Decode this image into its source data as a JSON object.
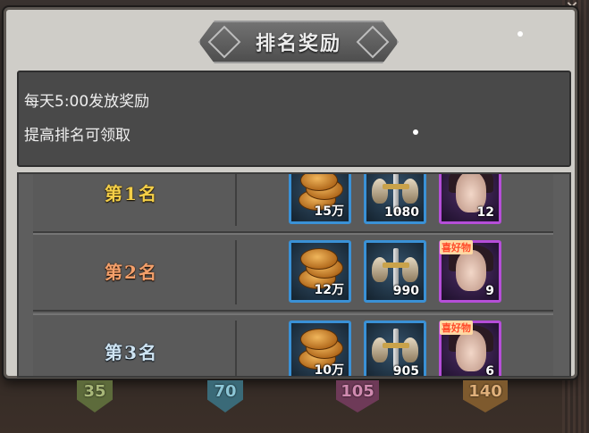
{
  "modal": {
    "title": "排名奖励",
    "close_icon": "x-icon"
  },
  "info": {
    "line1": "每天5:00发放奖励",
    "line2": "提高排名可领取"
  },
  "ranks": [
    {
      "label": "第1名",
      "style": "gold",
      "rewards": [
        {
          "type": "coins",
          "qty": "15万"
        },
        {
          "type": "sword-crest",
          "qty": "1080"
        },
        {
          "type": "portrait",
          "qty": "12",
          "tag": ""
        }
      ]
    },
    {
      "label": "第2名",
      "style": "copper",
      "rewards": [
        {
          "type": "coins",
          "qty": "12万"
        },
        {
          "type": "sword-crest",
          "qty": "990"
        },
        {
          "type": "portrait",
          "qty": "9",
          "tag": "喜好物"
        }
      ]
    },
    {
      "label": "第3名",
      "style": "silver",
      "rewards": [
        {
          "type": "coins",
          "qty": "10万"
        },
        {
          "type": "sword-crest",
          "qty": "905"
        },
        {
          "type": "portrait",
          "qty": "6",
          "tag": "喜好物"
        }
      ]
    }
  ],
  "milestones": [
    {
      "value": "35",
      "color": "#7a8f4e"
    },
    {
      "value": "70",
      "color": "#4f8fa3"
    },
    {
      "value": "105",
      "color": "#9a4f7a"
    },
    {
      "value": "140",
      "color": "#b88545"
    }
  ]
}
